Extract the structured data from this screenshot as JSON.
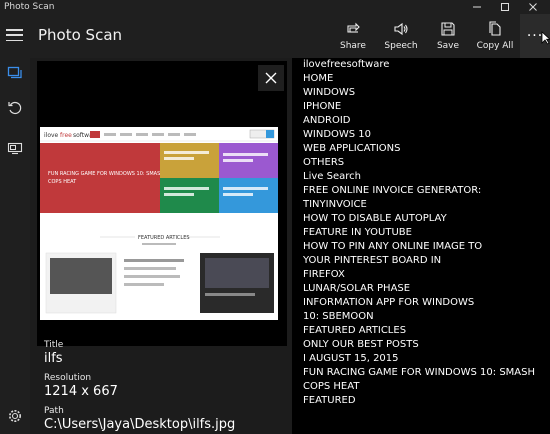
{
  "window": {
    "title": "Photo Scan",
    "controls": [
      "minimize",
      "maximize",
      "close"
    ]
  },
  "header": {
    "title": "Photo Scan",
    "commands": [
      {
        "label": "Share",
        "icon": "share-icon"
      },
      {
        "label": "Speech",
        "icon": "speaker-icon"
      },
      {
        "label": "Save",
        "icon": "save-icon"
      },
      {
        "label": "Copy All",
        "icon": "copy-icon"
      }
    ],
    "more_label": "···"
  },
  "rail": {
    "icons": [
      "gallery-icon",
      "refresh-icon",
      "screen-icon",
      "gear-icon"
    ]
  },
  "photo": {
    "close_icon": "close-icon",
    "thumbnail_icon": "webpage-screenshot-icon",
    "thumbnail_text": {
      "tile_red": "FUN RACING GAME FOR WINDOWS 10: SMASH COPS HEAT",
      "section_title": "FEATURED ARTICLES"
    },
    "colors": {
      "red": "#c0393b",
      "yellow": "#c9a23a",
      "purple": "#9b59d0",
      "green": "#1f8a4b",
      "blue": "#3498db"
    }
  },
  "details": {
    "title_label": "Title",
    "title_value": "ilfs",
    "resolution_label": "Resolution",
    "resolution_value": "1214 x 667",
    "path_label": "Path",
    "path_value": "C:\\Users\\Jaya\\Desktop\\ilfs.jpg"
  },
  "ocr": {
    "lines": [
      "ilovefreesoftware",
      "HOME",
      "WINDOWS",
      "IPHONE",
      "ANDROID",
      "WINDOWS 10",
      "WEB APPLICATIONS",
      "OTHERS",
      "Live Search",
      "FREE ONLINE INVOICE GENERATOR:",
      "TINYINVOICE",
      "HOW TO DISABLE AUTOPLAY",
      "FEATURE IN YOUTUBE",
      "HOW TO PIN ANY ONLINE IMAGE TO",
      "YOUR PINTEREST BOARD IN",
      "FIREFOX",
      "LUNAR/SOLAR PHASE",
      "INFORMATION APP FOR WINDOWS",
      "10: SBEMOON",
      "FEATURED ARTICLES",
      "ONLY OUR BEST POSTS",
      "I AUGUST 15, 2015",
      "FUN RACING GAME FOR WINDOWS 10: SMASH",
      "COPS HEAT",
      "FEATURED"
    ]
  }
}
